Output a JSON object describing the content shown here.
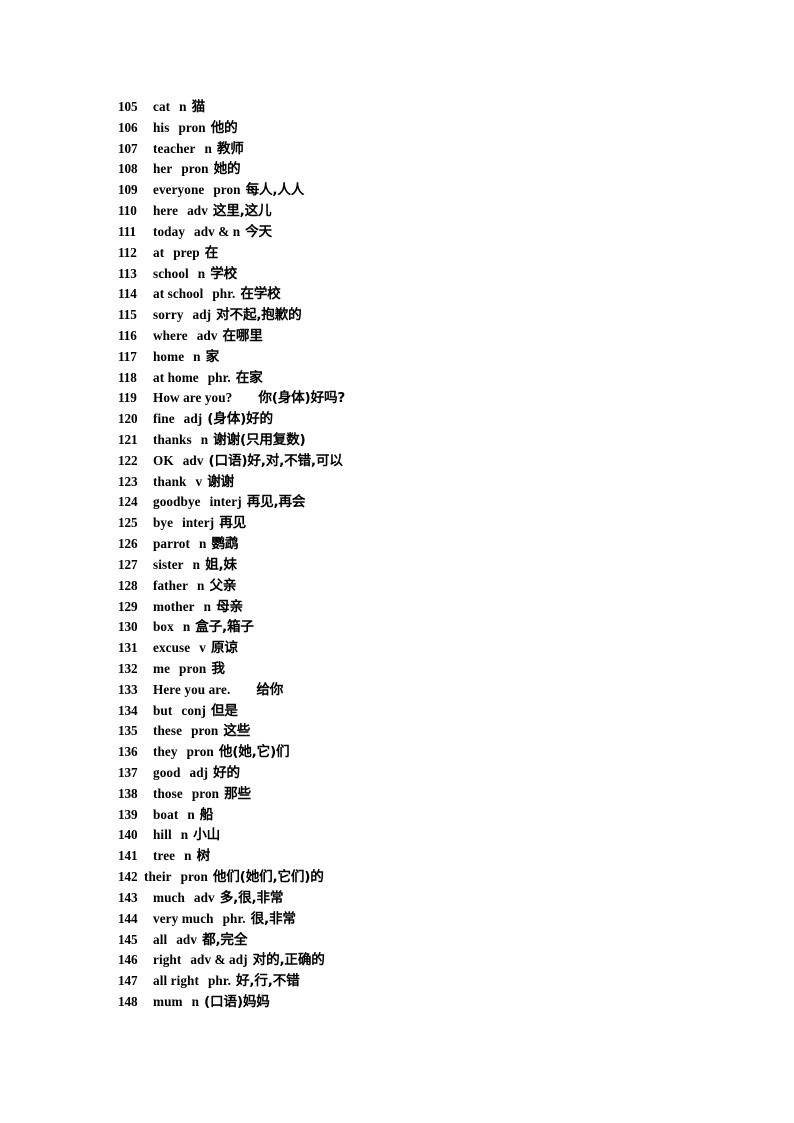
{
  "page": {
    "background_color": "#ffffff",
    "text_color": "#000000",
    "title": "English-Chinese Vocabulary List 105-148"
  },
  "vocab": {
    "entries": [
      {
        "num": "105",
        "word": "cat",
        "pos": "n",
        "def": "猫",
        "num_gap": "normal",
        "word_gap": "md",
        "pos_gap": "sm"
      },
      {
        "num": "106",
        "word": "his",
        "pos": "pron",
        "def": "他的",
        "num_gap": "normal",
        "word_gap": "md",
        "pos_gap": "sm"
      },
      {
        "num": "107",
        "word": "teacher",
        "pos": "n",
        "def": "教师",
        "num_gap": "normal",
        "word_gap": "md",
        "pos_gap": "sm"
      },
      {
        "num": "108",
        "word": "her",
        "pos": "pron",
        "def": "她的",
        "num_gap": "normal",
        "word_gap": "md",
        "pos_gap": "sm"
      },
      {
        "num": "109",
        "word": "everyone",
        "pos": "pron",
        "def": "每人,人人",
        "num_gap": "normal",
        "word_gap": "md",
        "pos_gap": "sm"
      },
      {
        "num": "110",
        "word": "here",
        "pos": "adv",
        "def": "这里,这儿",
        "num_gap": "normal",
        "word_gap": "md",
        "pos_gap": "sm"
      },
      {
        "num": "111",
        "word": "today",
        "pos": "adv & n",
        "def": "今天",
        "num_gap": "normal",
        "word_gap": "md",
        "pos_gap": "sm"
      },
      {
        "num": "112",
        "word": "at",
        "pos": "prep",
        "def": "在",
        "num_gap": "normal",
        "word_gap": "md",
        "pos_gap": "sm"
      },
      {
        "num": "113",
        "word": "school",
        "pos": "n",
        "def": "学校",
        "num_gap": "normal",
        "word_gap": "md",
        "pos_gap": "sm"
      },
      {
        "num": "114",
        "word": "at school",
        "pos": "phr.",
        "def": "在学校",
        "num_gap": "normal",
        "word_gap": "md",
        "pos_gap": "sm"
      },
      {
        "num": "115",
        "word": "sorry",
        "pos": "adj",
        "def": "对不起,抱歉的",
        "num_gap": "normal",
        "word_gap": "md",
        "pos_gap": "sm"
      },
      {
        "num": "116",
        "word": "where",
        "pos": "adv",
        "def": "在哪里",
        "num_gap": "normal",
        "word_gap": "md",
        "pos_gap": "sm"
      },
      {
        "num": "117",
        "word": "home",
        "pos": "n",
        "def": "家",
        "num_gap": "normal",
        "word_gap": "md",
        "pos_gap": "sm"
      },
      {
        "num": "118",
        "word": "at home",
        "pos": "phr.",
        "def": "在家",
        "num_gap": "normal",
        "word_gap": "md",
        "pos_gap": "sm"
      },
      {
        "num": "119",
        "word": "How are you?",
        "pos": "",
        "def": "你(身体)好吗?",
        "num_gap": "normal",
        "word_gap": "xl",
        "pos_gap": "none"
      },
      {
        "num": "120",
        "word": "fine",
        "pos": "adj",
        "def": "(身体)好的",
        "num_gap": "normal",
        "word_gap": "md",
        "pos_gap": "sm"
      },
      {
        "num": "121",
        "word": "thanks",
        "pos": "n",
        "def": "谢谢(只用复数)",
        "num_gap": "normal",
        "word_gap": "md",
        "pos_gap": "sm"
      },
      {
        "num": "122",
        "word": "OK",
        "pos": "adv",
        "def": "(口语)好,对,不错,可以",
        "num_gap": "normal",
        "word_gap": "md",
        "pos_gap": "sm"
      },
      {
        "num": "123",
        "word": "thank",
        "pos": "v",
        "def": "谢谢",
        "num_gap": "normal",
        "word_gap": "md",
        "pos_gap": "sm"
      },
      {
        "num": "124",
        "word": "goodbye",
        "pos": "interj",
        "def": "再见,再会",
        "num_gap": "normal",
        "word_gap": "md",
        "pos_gap": "sm"
      },
      {
        "num": "125",
        "word": "bye",
        "pos": "interj",
        "def": "再见",
        "num_gap": "normal",
        "word_gap": "md",
        "pos_gap": "sm"
      },
      {
        "num": "126",
        "word": "parrot",
        "pos": "n",
        "def": "鹦鹉",
        "num_gap": "normal",
        "word_gap": "md",
        "pos_gap": "sm"
      },
      {
        "num": "127",
        "word": "sister",
        "pos": "n",
        "def": "姐,妹",
        "num_gap": "normal",
        "word_gap": "md",
        "pos_gap": "sm"
      },
      {
        "num": "128",
        "word": "father",
        "pos": "n",
        "def": "父亲",
        "num_gap": "normal",
        "word_gap": "md",
        "pos_gap": "sm"
      },
      {
        "num": "129",
        "word": "mother",
        "pos": "n",
        "def": "母亲",
        "num_gap": "normal",
        "word_gap": "md",
        "pos_gap": "sm"
      },
      {
        "num": "130",
        "word": "box",
        "pos": "n",
        "def": "盒子,箱子",
        "num_gap": "normal",
        "word_gap": "md",
        "pos_gap": "sm"
      },
      {
        "num": "131",
        "word": "excuse",
        "pos": "v",
        "def": "原谅",
        "num_gap": "normal",
        "word_gap": "md",
        "pos_gap": "sm"
      },
      {
        "num": "132",
        "word": "me",
        "pos": "pron",
        "def": "我",
        "num_gap": "normal",
        "word_gap": "md",
        "pos_gap": "sm"
      },
      {
        "num": "133",
        "word": "Here you are.",
        "pos": "",
        "def": "给你",
        "num_gap": "normal",
        "word_gap": "xl",
        "pos_gap": "none"
      },
      {
        "num": "134",
        "word": "but",
        "pos": "conj",
        "def": "但是",
        "num_gap": "normal",
        "word_gap": "md",
        "pos_gap": "sm"
      },
      {
        "num": "135",
        "word": "these",
        "pos": "pron",
        "def": "这些",
        "num_gap": "normal",
        "word_gap": "md",
        "pos_gap": "sm"
      },
      {
        "num": "136",
        "word": "they",
        "pos": "pron",
        "def": "他(她,它)们",
        "num_gap": "normal",
        "word_gap": "md",
        "pos_gap": "sm"
      },
      {
        "num": "137",
        "word": "good",
        "pos": "adj",
        "def": "好的",
        "num_gap": "normal",
        "word_gap": "md",
        "pos_gap": "sm"
      },
      {
        "num": "138",
        "word": "those",
        "pos": "pron",
        "def": "那些",
        "num_gap": "normal",
        "word_gap": "md",
        "pos_gap": "sm"
      },
      {
        "num": "139",
        "word": "boat",
        "pos": "n",
        "def": "船",
        "num_gap": "normal",
        "word_gap": "md",
        "pos_gap": "sm"
      },
      {
        "num": "140",
        "word": "hill",
        "pos": "n",
        "def": "小山",
        "num_gap": "normal",
        "word_gap": "md",
        "pos_gap": "sm"
      },
      {
        "num": "141",
        "word": "tree",
        "pos": "n",
        "def": "树",
        "num_gap": "normal",
        "word_gap": "md",
        "pos_gap": "sm"
      },
      {
        "num": "142",
        "word": "their",
        "pos": "pron",
        "def": "他们(她们,它们)的",
        "num_gap": "tight",
        "word_gap": "md",
        "pos_gap": "sm"
      },
      {
        "num": "143",
        "word": "much",
        "pos": "adv",
        "def": "多,很,非常",
        "num_gap": "normal",
        "word_gap": "md",
        "pos_gap": "sm"
      },
      {
        "num": "144",
        "word": "very much",
        "pos": "phr.",
        "def": "很,非常",
        "num_gap": "normal",
        "word_gap": "md",
        "pos_gap": "sm"
      },
      {
        "num": "145",
        "word": "all",
        "pos": "adv",
        "def": "都,完全",
        "num_gap": "normal",
        "word_gap": "md",
        "pos_gap": "sm"
      },
      {
        "num": "146",
        "word": "right",
        "pos": "adv & adj",
        "def": "对的,正确的",
        "num_gap": "normal",
        "word_gap": "md",
        "pos_gap": "sm"
      },
      {
        "num": "147",
        "word": "all right",
        "pos": "phr.",
        "def": "好,行,不错",
        "num_gap": "normal",
        "word_gap": "md",
        "pos_gap": "sm"
      },
      {
        "num": "148",
        "word": "mum",
        "pos": "n",
        "def": "(口语)妈妈",
        "num_gap": "normal",
        "word_gap": "md",
        "pos_gap": "sm"
      }
    ]
  }
}
